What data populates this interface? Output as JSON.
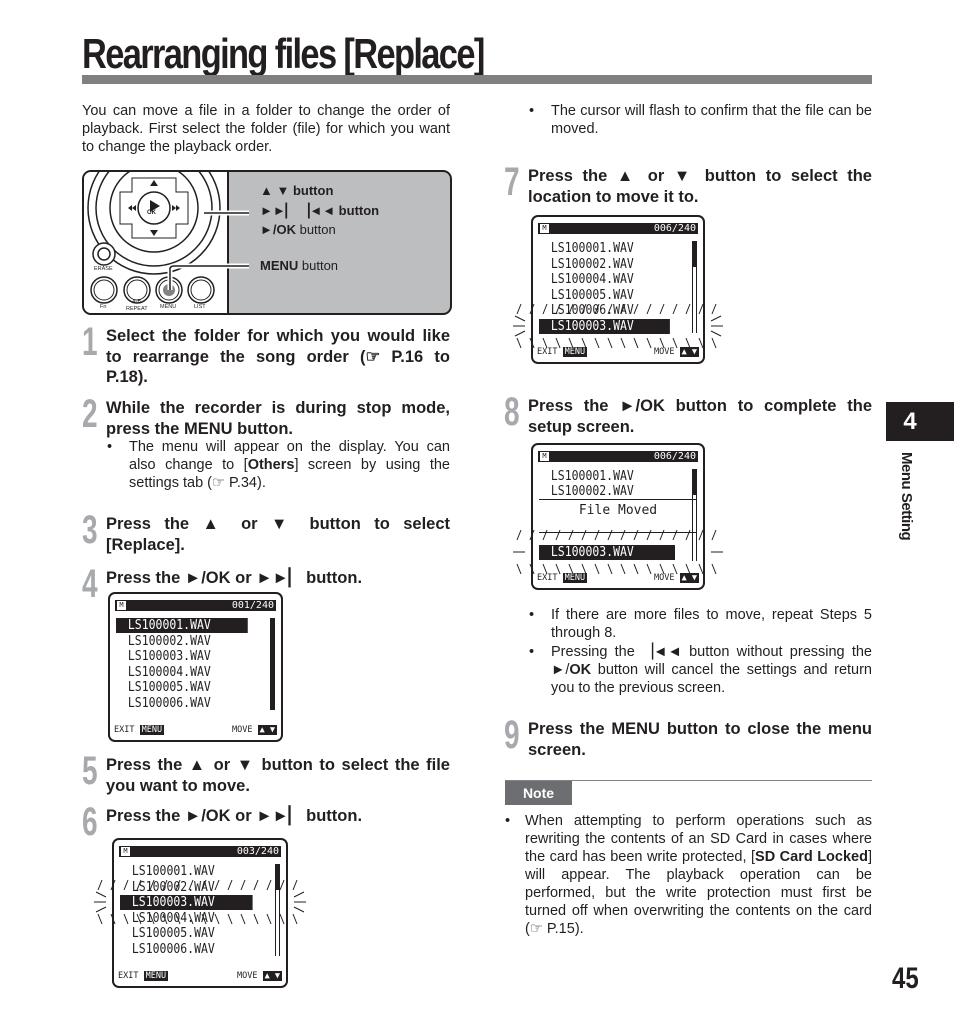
{
  "page": {
    "title": "Rearranging files [Replace]",
    "page_number": "45",
    "chapter_number": "4",
    "chapter_label": "Menu Setting"
  },
  "intro": "You can move a file in a folder to change the order of playback. First select the folder (file) for which you want to change the playback order.",
  "diagram": {
    "labels": {
      "updown": "▲ ▼ button",
      "skip": "►►▏ ▕◄◄ button",
      "play_prefix": "►/",
      "play_ok": "OK",
      "play_suffix": " button",
      "menu_bold": "MENU",
      "menu_suffix": " button"
    },
    "device_labels": {
      "erase": "ERASE",
      "fn": "Fn",
      "ab": "A-B",
      "repeat": "REPEAT",
      "menu": "MENU",
      "list": "LIST",
      "ok": "OK"
    }
  },
  "steps": [
    {
      "num": "1",
      "parts": [
        "Select the folder for which you would like to rearrange the song order (☞ P.16 to P.18)."
      ]
    },
    {
      "num": "2",
      "pre": "While the recorder is during stop mode, press the ",
      "bold": "MENU",
      "post": " button.",
      "bullet": {
        "pre": "The menu will appear on the display. You can also change to [",
        "bold": "Others",
        "post": "] screen by using the settings tab (☞ P.34)."
      }
    },
    {
      "num": "3",
      "pre": "Press the ▲ or ▼ button to select [",
      "bold": "Replace",
      "post": "]."
    },
    {
      "num": "4",
      "pre": "Press the ►/",
      "bold": "OK",
      "post": " or ►►▏ button."
    },
    {
      "num": "5",
      "text": "Press the ▲ or ▼ button to select the file you want to move."
    },
    {
      "num": "6",
      "pre": "Press the ►/",
      "bold": "OK",
      "post": " or ►►▏ button.",
      "bullet": "The cursor will flash to confirm that the file can be moved."
    },
    {
      "num": "7",
      "text": "Press the ▲ or ▼ button to select the location to move it to."
    },
    {
      "num": "8",
      "pre": "Press the ►/",
      "bold": "OK",
      "post": " button to complete the setup screen.",
      "bullets": [
        "If there are more files to move, repeat Steps 5 through 8.",
        {
          "pre": "Pressing the ▕◄◄ button without pressing the ►/",
          "bold": "OK",
          "post": " button will cancel the settings and return you to the previous screen."
        }
      ]
    },
    {
      "num": "9",
      "pre": "Press the ",
      "bold": "MENU",
      "post": " button to close the menu screen."
    }
  ],
  "screens": {
    "common": {
      "folder_icon": "M",
      "exit_label": "EXIT",
      "menu_key": "MENU",
      "move_label": "MOVE",
      "move_keys": "▲ ▼"
    },
    "s4": {
      "counter": "001/240",
      "rows": [
        "LS100001.WAV",
        "LS100002.WAV",
        "LS100003.WAV",
        "LS100004.WAV",
        "LS100005.WAV",
        "LS100006.WAV"
      ],
      "selected": 0
    },
    "s6": {
      "counter": "003/240",
      "rows": [
        "LS100001.WAV",
        "LS100002.WAV",
        "LS100003.WAV",
        "LS100004.WAV",
        "LS100005.WAV",
        "LS100006.WAV"
      ],
      "selected": 2
    },
    "s7": {
      "counter": "006/240",
      "rows": [
        "LS100001.WAV",
        "LS100002.WAV",
        "LS100004.WAV",
        "LS100005.WAV",
        "LS100006.WAV",
        "LS100003.WAV"
      ],
      "selected": 5
    },
    "s8": {
      "counter": "006/240",
      "rows": [
        "LS100001.WAV",
        "LS100002.WAV",
        "LS100003.WAV"
      ],
      "popup": "File Moved"
    }
  },
  "note": {
    "label": "Note",
    "pre": "When attempting to perform operations such as rewriting the contents of an SD Card in cases where the card has been write protected, [",
    "bold": "SD Card Locked",
    "post": "] will appear. The playback operation can be performed, but the write protection must first be turned off when overwriting the contents on the card (☞ P.15)."
  },
  "colors": {
    "ink": "#231f20",
    "gray_bar": "#808080",
    "step_num": "#a7a9ac",
    "diagram_bg": "#bcbec0",
    "note_tag": "#6d6e71"
  }
}
